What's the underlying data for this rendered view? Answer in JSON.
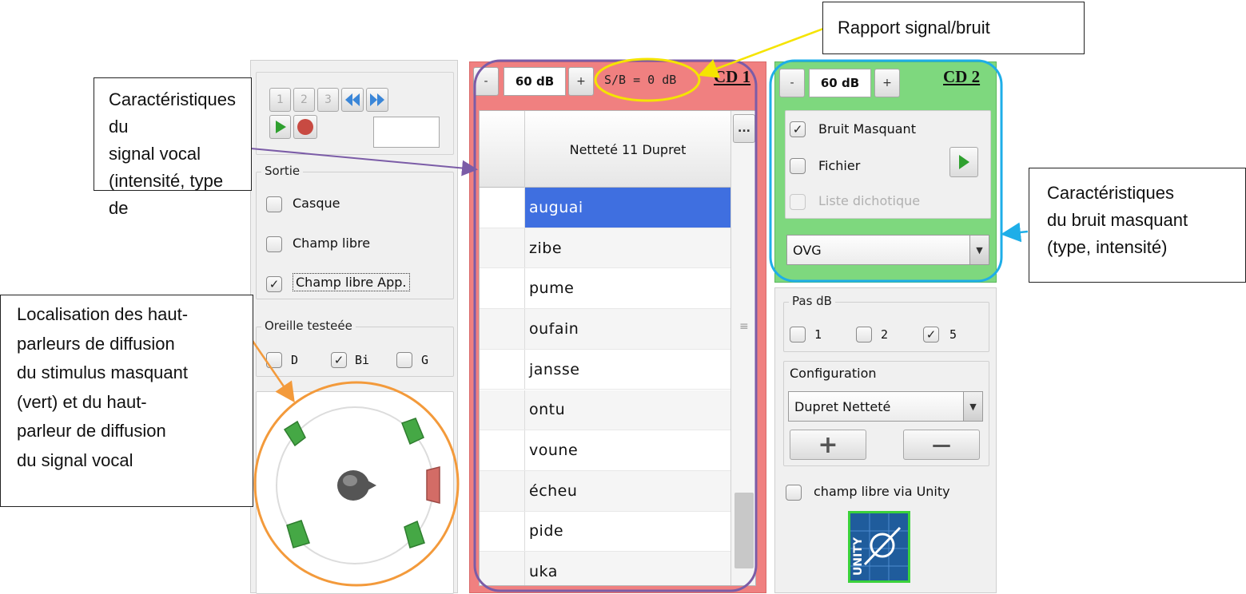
{
  "annotations": {
    "snr_callout": "Rapport signal/bruit",
    "voice_callout": "Caractéristiques du\nsignal vocal\n(intensité, type de",
    "noise_callout": "Caractéristiques\ndu bruit masquant\n(type, intensité)",
    "speaker_callout": "Localisation des haut-\nparleurs de diffusion\ndu stimulus masquant\n(vert) et du haut-\nparleur de diffusion\ndu signal vocal",
    "colors": {
      "purple": "#7b5ca7",
      "yellow": "#f5e400",
      "blue": "#1eaee8",
      "orange": "#f39a3b"
    }
  },
  "player": {
    "track_buttons": [
      "1",
      "2",
      "3"
    ],
    "rewind_icon": "double-chevron-left-icon",
    "forward_icon": "double-chevron-right-icon",
    "play_icon": "play-icon",
    "record_icon": "record-icon",
    "display_value": ""
  },
  "sortie": {
    "title": "Sortie",
    "options": [
      {
        "label": "Casque",
        "checked": false
      },
      {
        "label": "Champ libre",
        "checked": false
      },
      {
        "label": "Champ libre App.",
        "checked": true
      }
    ]
  },
  "oreille": {
    "title": "Oreille testeée",
    "options": [
      {
        "label": "D",
        "checked": false
      },
      {
        "label": "Bi",
        "checked": true
      },
      {
        "label": "G",
        "checked": false
      }
    ]
  },
  "cd1": {
    "minus": "-",
    "level": "60 dB",
    "plus": "+",
    "snr": "S/B = 0 dB",
    "title": "CD 1",
    "background": "#f08080",
    "list_header": "Netteté 11 Dupret",
    "more_button": "...",
    "scroll_grip": "≡",
    "words": [
      "auguai",
      "zibe",
      "pume",
      "oufain",
      "jansse",
      "ontu",
      "voune",
      "écheu",
      "pide",
      "uka"
    ],
    "selected_index": 0
  },
  "cd2": {
    "minus": "-",
    "level": "60 dB",
    "plus": "+",
    "title": "CD 2",
    "background": "#7ed87e",
    "bruit_masquant": {
      "label": "Bruit Masquant",
      "checked": true
    },
    "fichier": {
      "label": "Fichier",
      "checked": false
    },
    "liste_dichotique": {
      "label": "Liste dichotique",
      "checked": false,
      "disabled": true
    },
    "noise_type": "OVG"
  },
  "pas_db": {
    "title": "Pas dB",
    "options": [
      {
        "label": "1",
        "checked": false
      },
      {
        "label": "2",
        "checked": false
      },
      {
        "label": "5",
        "checked": true
      }
    ]
  },
  "configuration": {
    "title": "Configuration",
    "selected": "Dupret Netteté",
    "add_label": "+",
    "remove_label": "—"
  },
  "unity": {
    "label": "champ libre via Unity",
    "checked": false,
    "logo_text": "UNITY"
  }
}
